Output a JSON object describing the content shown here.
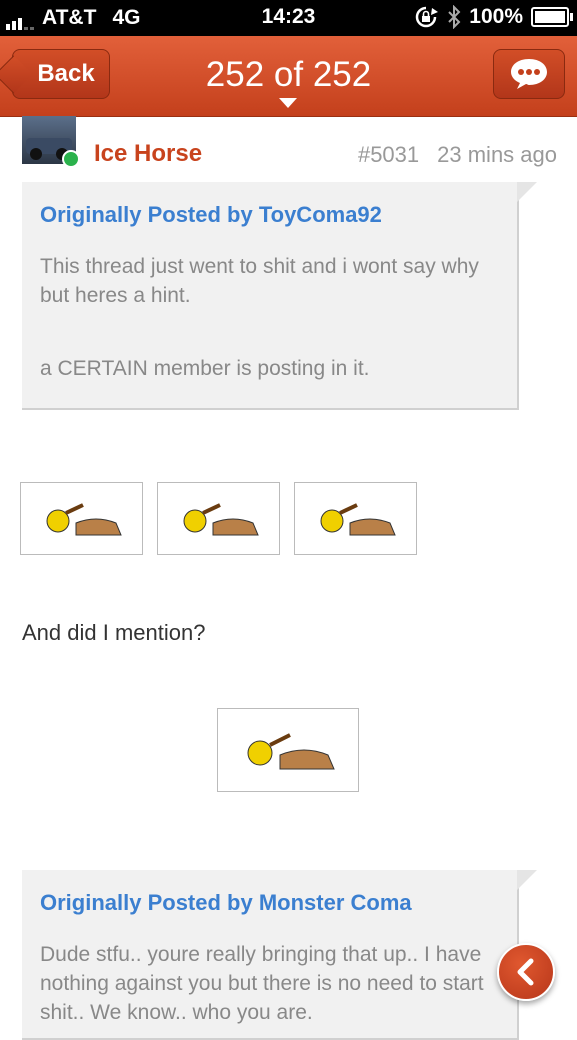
{
  "status_bar": {
    "carrier": "AT&T",
    "network": "4G",
    "time": "14:23",
    "battery": "100%"
  },
  "nav": {
    "back_label": "Back",
    "title": "252 of 252"
  },
  "post": {
    "author": "Ice Horse",
    "number": "#5031",
    "time_ago": "23 mins ago",
    "quote1": {
      "title": "Originally Posted by ToyComa92",
      "line1": "This thread just went to shit and i wont say why but heres a hint.",
      "line2": "a CERTAIN member is posting in it."
    },
    "body": "And did I mention?",
    "quote2": {
      "title": "Originally Posted by Monster Coma",
      "text": "Dude stfu.. youre really bringing that up.. I have nothing against you but there is no need to start shit.. We know.. who you are."
    }
  },
  "colors": {
    "accent": "#c8431d",
    "link": "#3b7fd0",
    "online": "#2bb24c"
  },
  "icons": {
    "chat": "speech-bubble-icon",
    "back_float": "chevron-left-icon",
    "location": "rotation-lock-icon",
    "bluetooth": "bluetooth-icon"
  }
}
